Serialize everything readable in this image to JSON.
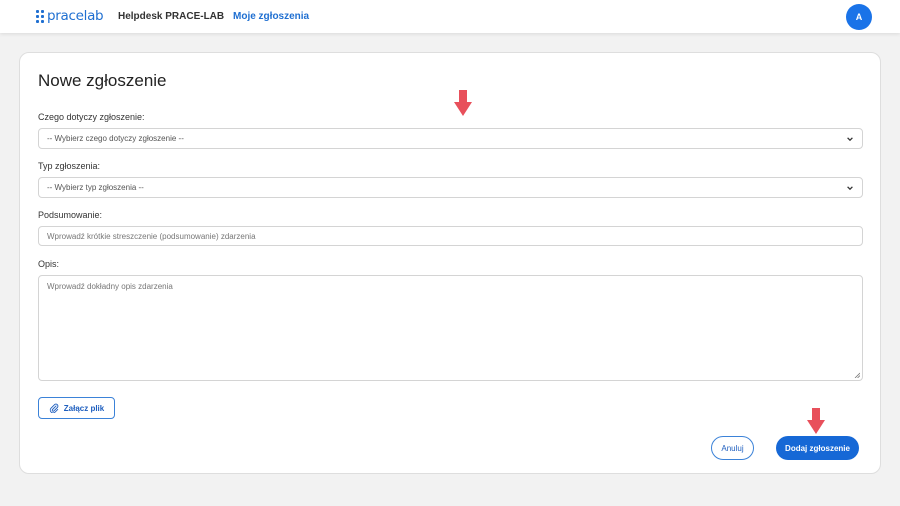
{
  "header": {
    "logo_text": "pracelab",
    "app_title": "Helpdesk PRACE-LAB",
    "nav_link": "Moje zgłoszenia",
    "avatar_initial": "A"
  },
  "form": {
    "title": "Nowe zgłoszenie",
    "category": {
      "label": "Czego dotyczy zgłoszenie:",
      "selected": "-- Wybierz czego dotyczy zgłoszenie --"
    },
    "type": {
      "label": "Typ zgłoszenia:",
      "selected": "-- Wybierz typ zgłoszenia --"
    },
    "summary": {
      "label": "Podsumowanie:",
      "value": "",
      "placeholder": "Wprowadź krótkie streszczenie (podsumowanie) zdarzenia"
    },
    "description": {
      "label": "Opis:",
      "value": "",
      "placeholder": "Wprowadź dokładny opis zdarzenia"
    },
    "attach_label": "Załącz plik",
    "cancel_label": "Anuluj",
    "submit_label": "Dodaj zgłoszenie"
  },
  "colors": {
    "brand": "#1f6fd1",
    "primary_button": "#1668d6",
    "annotation_arrow": "#e8505b",
    "page_background": "#f2f2f2"
  },
  "icons": {
    "logo": "pracelab-dots-logo",
    "select_indicator": "chevron-down-icon",
    "attach": "paperclip-icon",
    "annotation": "arrow-down-icon"
  }
}
